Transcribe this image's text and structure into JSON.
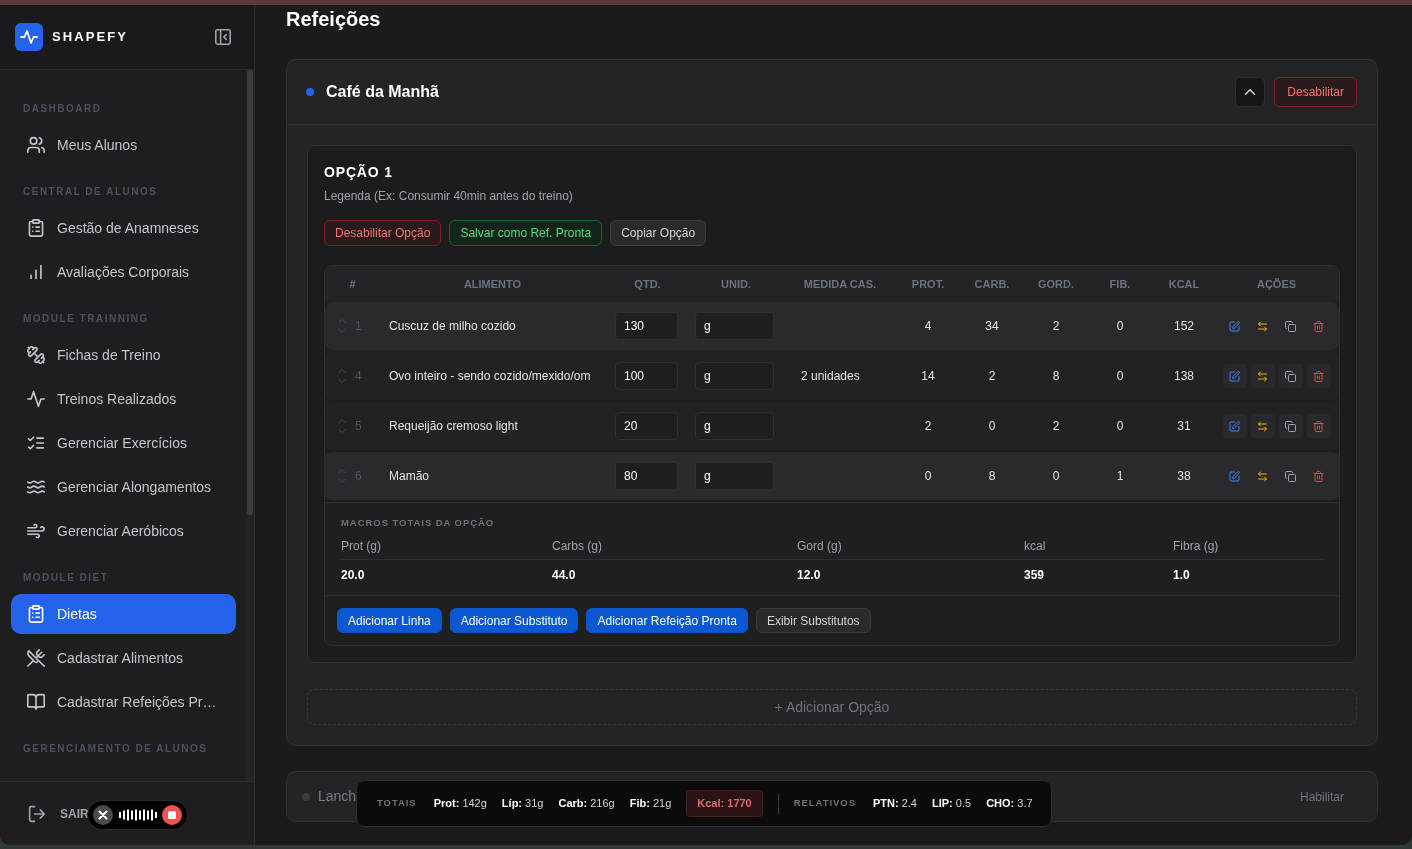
{
  "sidebar": {
    "brand": "SHAPEFY",
    "sections": [
      {
        "title": "DASHBOARD",
        "items": [
          {
            "label": "Meus Alunos",
            "selected": false
          }
        ]
      },
      {
        "title": "CENTRAL DE ALUNOS",
        "items": [
          {
            "label": "Gestão de Anamneses",
            "selected": false
          },
          {
            "label": "Avaliações Corporais",
            "selected": false
          }
        ]
      },
      {
        "title": "MODULE TRAINNING",
        "items": [
          {
            "label": "Fichas de Treino",
            "selected": false
          },
          {
            "label": "Treinos Realizados",
            "selected": false
          },
          {
            "label": "Gerenciar Exercícios",
            "selected": false
          },
          {
            "label": "Gerenciar Alongamentos",
            "selected": false
          },
          {
            "label": "Gerenciar Aeróbicos",
            "selected": false
          }
        ]
      },
      {
        "title": "MODULE DIET",
        "items": [
          {
            "label": "Dietas",
            "selected": true
          },
          {
            "label": "Cadastrar Alimentos",
            "selected": false
          },
          {
            "label": "Cadastrar Refeições Pr…",
            "selected": false
          }
        ]
      },
      {
        "title": "GERENCIAMENTO DE ALUNOS"
      }
    ],
    "logout": "SAIR"
  },
  "main": {
    "title": "Refeições",
    "meals": [
      {
        "name": "Café da Manhã",
        "enabled": true,
        "expanded": true,
        "toggle_label": "Desabilitar",
        "options": [
          {
            "title": "OPÇÃO 1",
            "caption": "Legenda (Ex: Consumir 40min antes do treino)",
            "actions": [
              {
                "label": "Desabilitar Opção",
                "kind": "danger"
              },
              {
                "label": "Salvar como Ref. Pronta",
                "kind": "success"
              },
              {
                "label": "Copiar Opção",
                "kind": "neutral"
              }
            ],
            "table": {
              "columns": [
                "#",
                "ALIMENTO",
                "QTD.",
                "UNID.",
                "MEDIDA CAS.",
                "PROT.",
                "CARB.",
                "GORD.",
                "FIB.",
                "KCAL",
                "AÇÕES"
              ],
              "rows": [
                {
                  "number": "1",
                  "food": "Cuscuz de milho cozido",
                  "quantity": "130",
                  "unit": "g",
                  "protein": "4",
                  "carbs": "34",
                  "fat": "2",
                  "fiber": "0",
                  "kcal": "152",
                  "highlighted": true
                },
                {
                  "number": "4",
                  "food": "Ovo inteiro - sendo cozido/mexido/om",
                  "quantity": "100",
                  "unit": "g",
                  "household_measure": "2 unidades",
                  "protein": "14",
                  "carbs": "2",
                  "fat": "8",
                  "fiber": "0",
                  "kcal": "138",
                  "highlighted": false
                },
                {
                  "number": "5",
                  "food": "Requeijão cremoso light",
                  "quantity": "20",
                  "unit": "g",
                  "protein": "2",
                  "carbs": "0",
                  "fat": "2",
                  "fiber": "0",
                  "kcal": "31",
                  "highlighted": false
                },
                {
                  "number": "6",
                  "food": "Mamão",
                  "quantity": "80",
                  "unit": "g",
                  "protein": "0",
                  "carbs": "8",
                  "fat": "0",
                  "fiber": "1",
                  "kcal": "38",
                  "highlighted": true
                }
              ]
            },
            "macros": {
              "title": "MACROS TOTAIS DA OPÇÃO",
              "labels": [
                "Prot (g)",
                "Carbs (g)",
                "Gord (g)",
                "kcal",
                "Fibra (g)"
              ],
              "values": [
                "20.0",
                "44.0",
                "12.0",
                "359",
                "1.0"
              ]
            },
            "buttons": [
              {
                "label": "Adicionar Linha",
                "kind": "primary"
              },
              {
                "label": "Adicionar Substituto",
                "kind": "primary"
              },
              {
                "label": "Adicionar Refeição Pronta",
                "kind": "primary"
              },
              {
                "label": "Exibir Substitutos",
                "kind": "secondary"
              }
            ]
          }
        ],
        "add_option_label": "+ Adicionar Opção"
      },
      {
        "name": "Lanch",
        "enabled": false,
        "expanded": false,
        "toggle_label": "Habilitar"
      }
    ]
  },
  "totals_bar": {
    "label": "TOTAIS",
    "items": [
      {
        "text": "**Prot:** 142g",
        "kind": "plain"
      },
      {
        "text": "**Líp:** 31g",
        "kind": "plain"
      },
      {
        "text": "**Carb:** 216g",
        "kind": "plain"
      },
      {
        "text": "**Fib:** 21g",
        "kind": "plain"
      },
      {
        "text": "**Kcal: 1770**",
        "kind": "alert"
      }
    ],
    "relative_label": "RELATIVOS",
    "relative_items": [
      "**PTN:** 2.4",
      "**LIP:** 0.5",
      "**CHO:** 3.7"
    ]
  }
}
